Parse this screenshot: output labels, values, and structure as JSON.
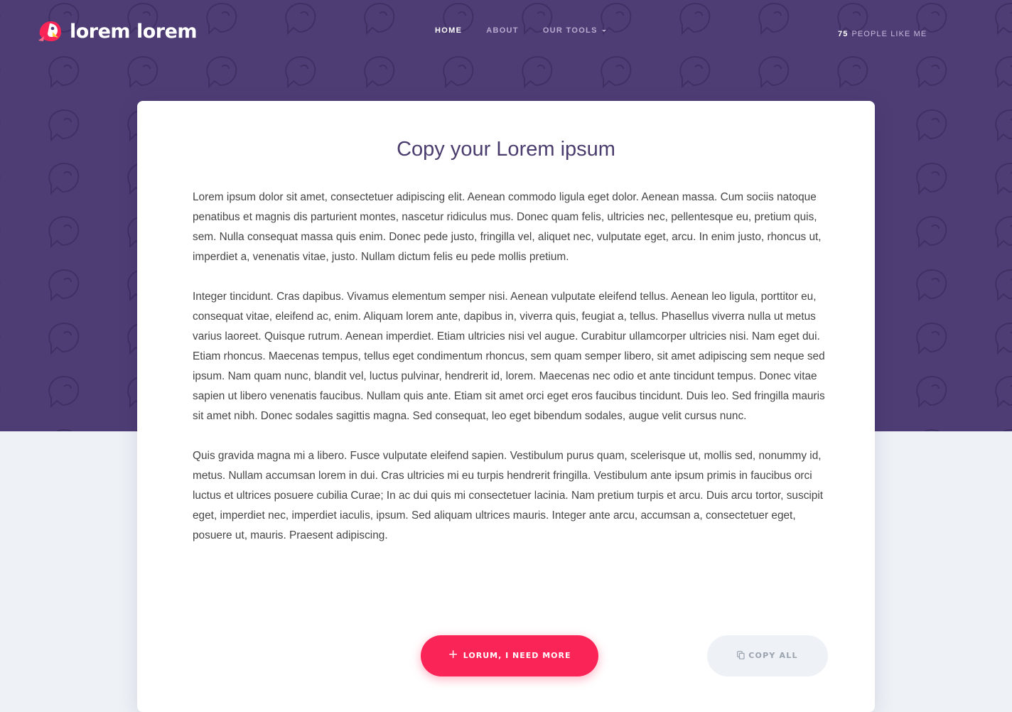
{
  "brand": {
    "name": "lorem lorem",
    "logo_icon": "parrot-logo-icon",
    "accent_color": "#fb2456"
  },
  "nav": {
    "items": [
      {
        "label": "HOME",
        "active": true
      },
      {
        "label": "ABOUT",
        "active": false
      },
      {
        "label": "OUR TOOLS",
        "active": false,
        "has_dropdown": true
      }
    ]
  },
  "likes": {
    "count": "75",
    "label": "PEOPLE LIKE ME"
  },
  "card": {
    "title": "Copy your Lorem ipsum",
    "paragraphs": [
      "Lorem ipsum dolor sit amet, consectetuer adipiscing elit. Aenean commodo ligula eget dolor. Aenean massa. Cum sociis natoque penatibus et magnis dis parturient montes, nascetur ridiculus mus. Donec quam felis, ultricies nec, pellentesque eu, pretium quis, sem. Nulla consequat massa quis enim. Donec pede justo, fringilla vel, aliquet nec, vulputate eget, arcu. In enim justo, rhoncus ut, imperdiet a, venenatis vitae, justo. Nullam dictum felis eu pede mollis pretium.",
      "Integer tincidunt. Cras dapibus. Vivamus elementum semper nisi. Aenean vulputate eleifend tellus. Aenean leo ligula, porttitor eu, consequat vitae, eleifend ac, enim. Aliquam lorem ante, dapibus in, viverra quis, feugiat a, tellus. Phasellus viverra nulla ut metus varius laoreet. Quisque rutrum. Aenean imperdiet. Etiam ultricies nisi vel augue. Curabitur ullamcorper ultricies nisi. Nam eget dui. Etiam rhoncus. Maecenas tempus, tellus eget condimentum rhoncus, sem quam semper libero, sit amet adipiscing sem neque sed ipsum. Nam quam nunc, blandit vel, luctus pulvinar, hendrerit id, lorem. Maecenas nec odio et ante tincidunt tempus. Donec vitae sapien ut libero venenatis faucibus. Nullam quis ante. Etiam sit amet orci eget eros faucibus tincidunt. Duis leo. Sed fringilla mauris sit amet nibh. Donec sodales sagittis magna. Sed consequat, leo eget bibendum sodales, augue velit cursus nunc.",
      "Quis gravida magna mi a libero. Fusce vulputate eleifend sapien. Vestibulum purus quam, scelerisque ut, mollis sed, nonummy id, metus. Nullam accumsan lorem in dui. Cras ultricies mi eu turpis hendrerit fringilla. Vestibulum ante ipsum primis in faucibus orci luctus et ultrices posuere cubilia Curae; In ac dui quis mi consectetuer lacinia. Nam pretium turpis et arcu. Duis arcu tortor, suscipit eget, imperdiet nec, imperdiet iaculis, ipsum. Sed aliquam ultrices mauris. Integer ante arcu, accumsan a, consectetuer eget, posuere ut, mauris. Praesent adipiscing."
    ]
  },
  "actions": {
    "more_label": "LORUM, I NEED MORE",
    "more_icon": "plus-icon",
    "copy_label": "COPY ALL",
    "copy_icon": "copy-icon"
  }
}
